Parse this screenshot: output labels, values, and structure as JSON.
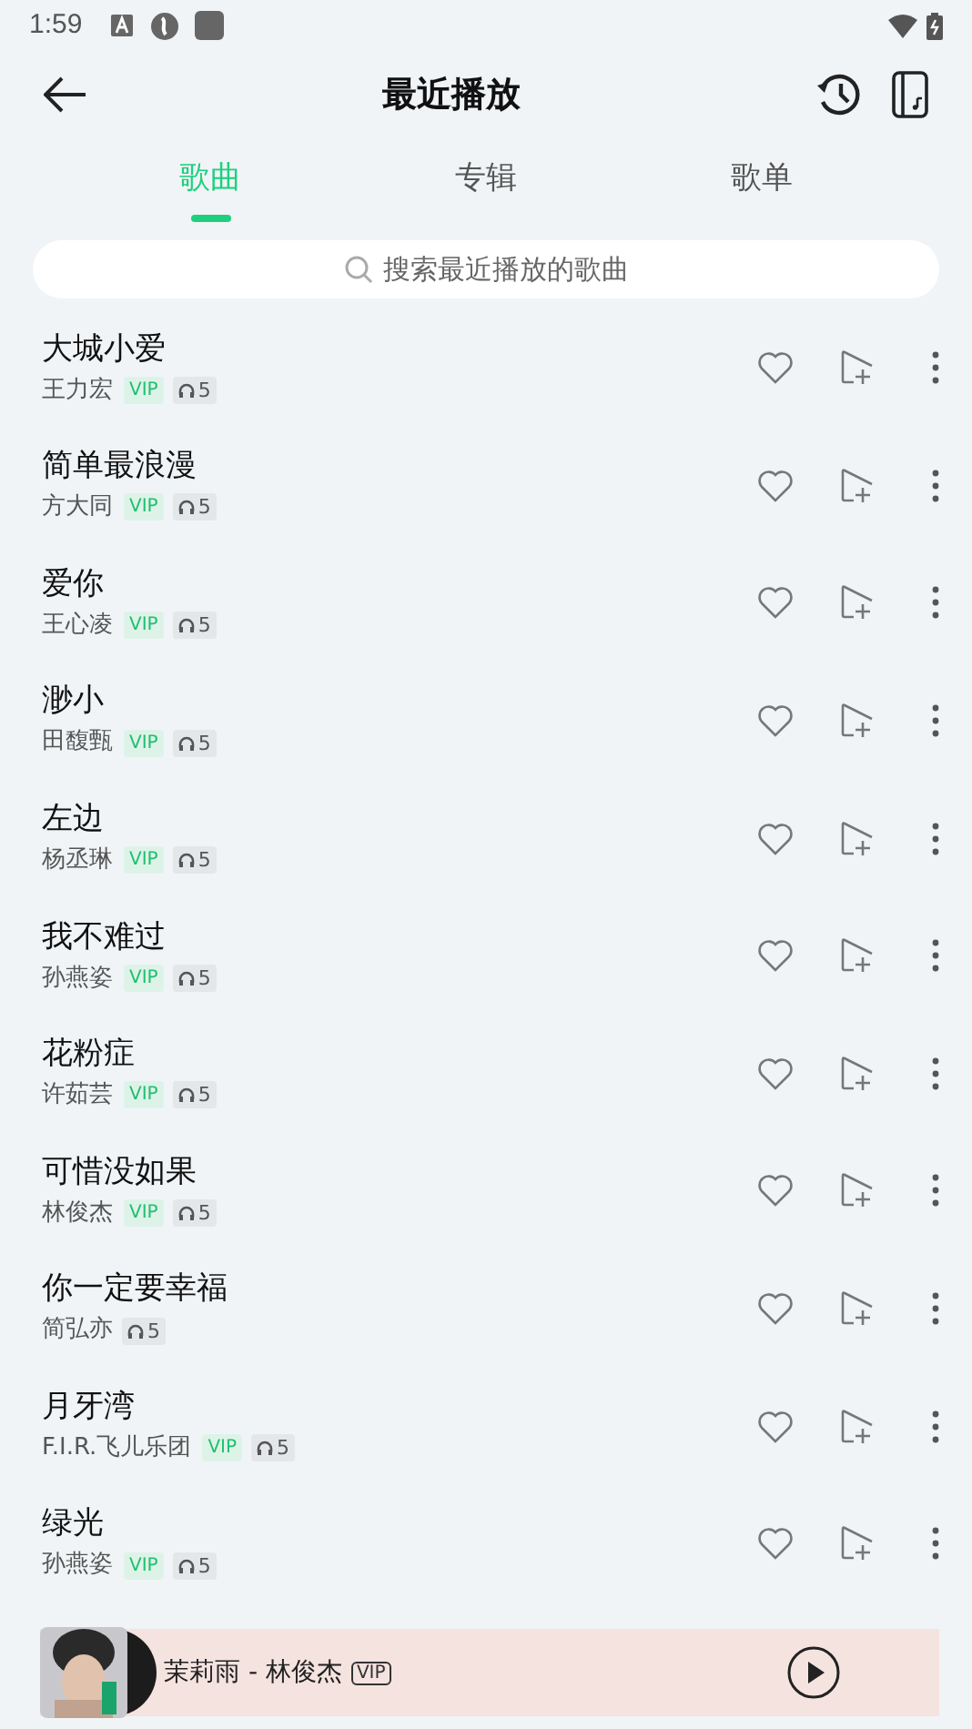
{
  "status_bar": {
    "time": "1:59"
  },
  "header": {
    "title": "最近播放"
  },
  "tabs": [
    {
      "label": "歌曲",
      "selected": true
    },
    {
      "label": "专辑",
      "selected": false
    },
    {
      "label": "歌单",
      "selected": false
    }
  ],
  "search": {
    "placeholder": "搜索最近播放的歌曲"
  },
  "songs": [
    {
      "title": "大城小爱",
      "artist": "王力宏",
      "badge": "VIP",
      "plays": "5"
    },
    {
      "title": "简单最浪漫",
      "artist": "方大同",
      "badge": "VIP",
      "plays": "5"
    },
    {
      "title": "爱你",
      "artist": "王心凌",
      "badge": "VIP",
      "plays": "5"
    },
    {
      "title": "渺小",
      "artist": "田馥甄",
      "badge": "VIP",
      "plays": "5"
    },
    {
      "title": "左边",
      "artist": "杨丞琳",
      "badge": "VIP",
      "plays": "5"
    },
    {
      "title": "我不难过",
      "artist": "孙燕姿",
      "badge": "VIP",
      "plays": "5"
    },
    {
      "title": "花粉症",
      "artist": "许茹芸",
      "badge": "VIP",
      "plays": "5"
    },
    {
      "title": "可惜没如果",
      "artist": "林俊杰",
      "badge": "VIP",
      "plays": "5"
    },
    {
      "title": "你一定要幸福",
      "artist": "简弘亦",
      "plays": "5"
    },
    {
      "title": "月牙湾",
      "artist": "F.I.R.飞儿乐团",
      "badge": "VIP",
      "plays": "5"
    },
    {
      "title": "绿光",
      "artist": "孙燕姿",
      "badge": "VIP",
      "plays": "5"
    }
  ],
  "player": {
    "track": "茉莉雨 - 林俊杰",
    "badge": "VIP"
  }
}
